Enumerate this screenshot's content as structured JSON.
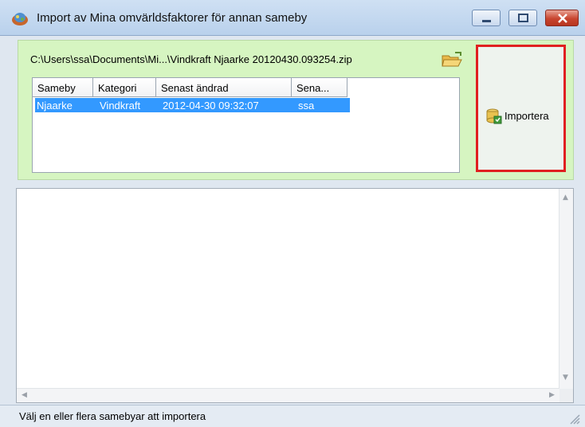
{
  "window": {
    "title": "Import av Mina omvärldsfaktorer för annan sameby"
  },
  "file": {
    "path": "C:\\Users\\ssa\\Documents\\Mi...\\Vindkraft Njaarke 20120430.093254.zip"
  },
  "table": {
    "columns": [
      "Sameby",
      "Kategori",
      "Senast ändrad",
      "Sena..."
    ],
    "rows": [
      {
        "sameby": "Njaarke",
        "kategori": "Vindkraft",
        "senast_andrad": "2012-04-30 09:32:07",
        "sena": "ssa",
        "selected": true
      }
    ]
  },
  "import_button": {
    "label": "Importera"
  },
  "status": {
    "text": "Välj en eller flera samebyar att importera"
  },
  "icons": {
    "app": "app-icon",
    "minimize": "minimize-icon",
    "maximize": "maximize-icon",
    "close": "close-icon",
    "folder": "open-folder-icon",
    "import": "database-import-icon",
    "grip": "resize-grip-icon"
  },
  "colors": {
    "selection": "#3399ff",
    "panel": "#d6f5c1",
    "highlight_border": "#e02020"
  }
}
